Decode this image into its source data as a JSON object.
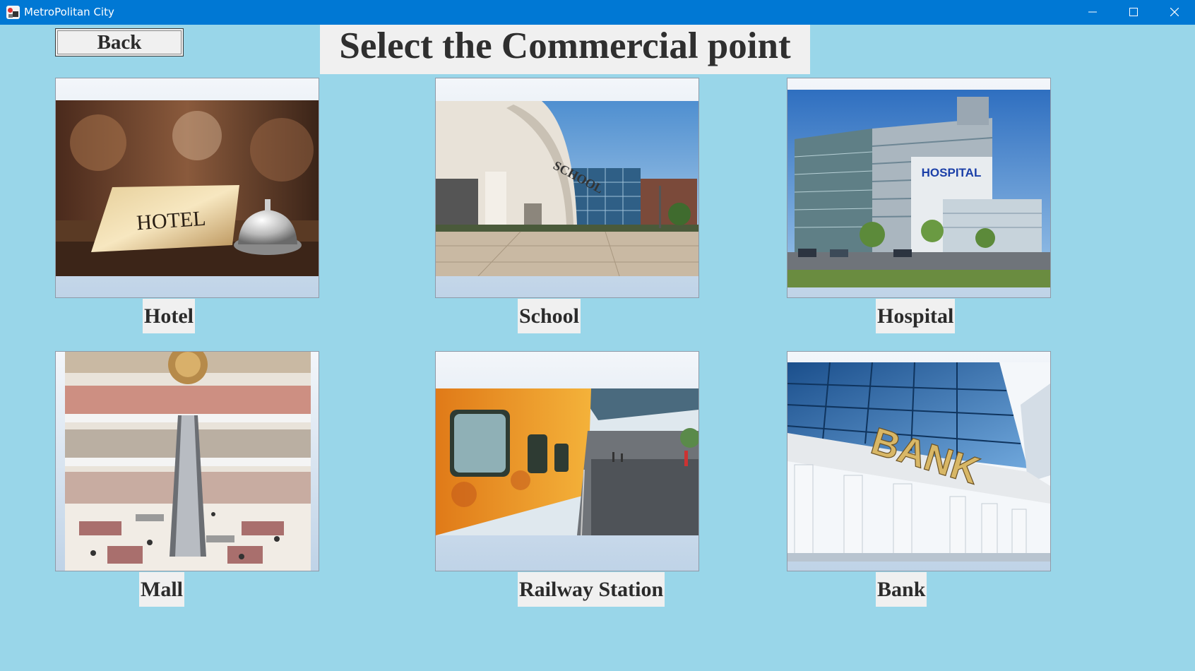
{
  "window": {
    "title": "MetroPolitan City",
    "controls": {
      "minimize": "minimize-icon",
      "maximize": "maximize-icon",
      "close": "close-icon"
    }
  },
  "toolbar": {
    "back_label": "Back"
  },
  "page": {
    "title": "Select the Commercial point"
  },
  "points": [
    {
      "label": "Hotel",
      "photo_text": "HOTEL"
    },
    {
      "label": "School",
      "photo_text": "SCHOOL"
    },
    {
      "label": "Hospital",
      "photo_text": "HOSPITAL"
    },
    {
      "label": "Mall"
    },
    {
      "label": "Railway Station"
    },
    {
      "label": "Bank",
      "photo_text": "BANK"
    }
  ],
  "colors": {
    "titlebar": "#0078d4",
    "background": "#99d6e9",
    "label_background": "#f0f0f0",
    "text": "#2b2b2b"
  }
}
